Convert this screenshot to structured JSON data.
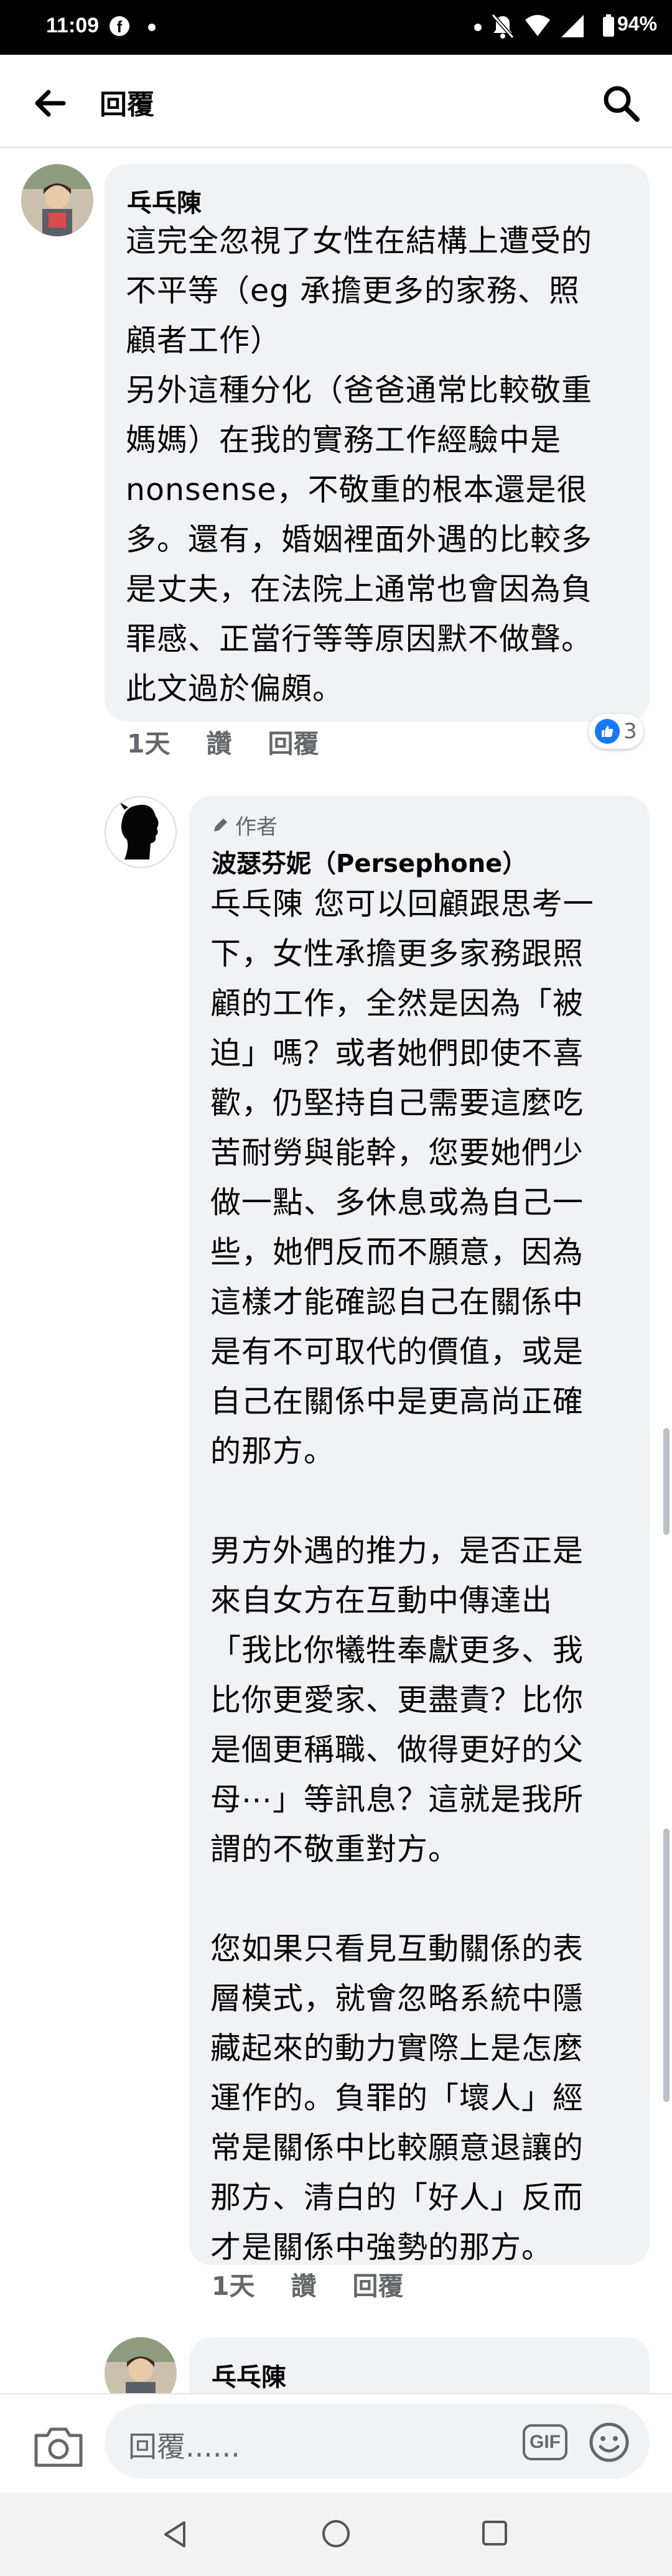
{
  "status_bar": {
    "time": "11:09",
    "battery": "94%"
  },
  "header": {
    "title": "回覆"
  },
  "comments": [
    {
      "author": "乓乓陳",
      "text": "這完全忽視了女性在結構上遭受的\n不平等（eg 承擔更多的家務、照\n顧者工作）\n另外這種分化（爸爸通常比較敬重\n媽媽）在我的實務工作經驗中是\nnonsense，不敬重的根本還是很\n多。還有，婚姻裡面外遇的比較多\n是丈夫，在法院上通常也會因為負\n罪感、正當行等等原因默不做聲。\n此文過於偏頗。",
      "time": "1天",
      "like_label": "讚",
      "reply_label": "回覆",
      "reaction_count": "3"
    },
    {
      "badge": "作者",
      "author": "波瑟芬妮（Persephone）",
      "text": "乓乓陳 您可以回顧跟思考一\n下，女性承擔更多家務跟照\n顧的工作，全然是因為「被\n迫」嗎？或者她們即使不喜\n歡，仍堅持自己需要這麼吃\n苦耐勞與能幹，您要她們少\n做一點、多休息或為自己一\n些，她們反而不願意，因為\n這樣才能確認自己在關係中\n是有不可取代的價值，或是\n自己在關係中是更高尚正確\n的那方。\n\n男方外遇的推力，是否正是\n來自女方在互動中傳達出\n「我比你犧牲奉獻更多、我\n比你更愛家、更盡責？比你\n是個更稱職、做得更好的父\n母⋯」等訊息？這就是我所\n謂的不敬重對方。\n\n您如果只看見互動關係的表\n層模式，就會忽略系統中隱\n藏起來的動力實際上是怎麼\n運作的。負罪的「壞人」經\n常是關係中比較願意退讓的\n那方、清白的「好人」反而\n才是關係中強勢的那方。",
      "time": "1天",
      "like_label": "讚",
      "reply_label": "回覆"
    },
    {
      "author": "乓乓陳"
    }
  ],
  "composer": {
    "placeholder": "回覆......",
    "gif_label": "GIF"
  },
  "colors": {
    "bubble": "#f0f2f5",
    "like_blue": "#1877f2",
    "secondary_text": "#65676b"
  }
}
